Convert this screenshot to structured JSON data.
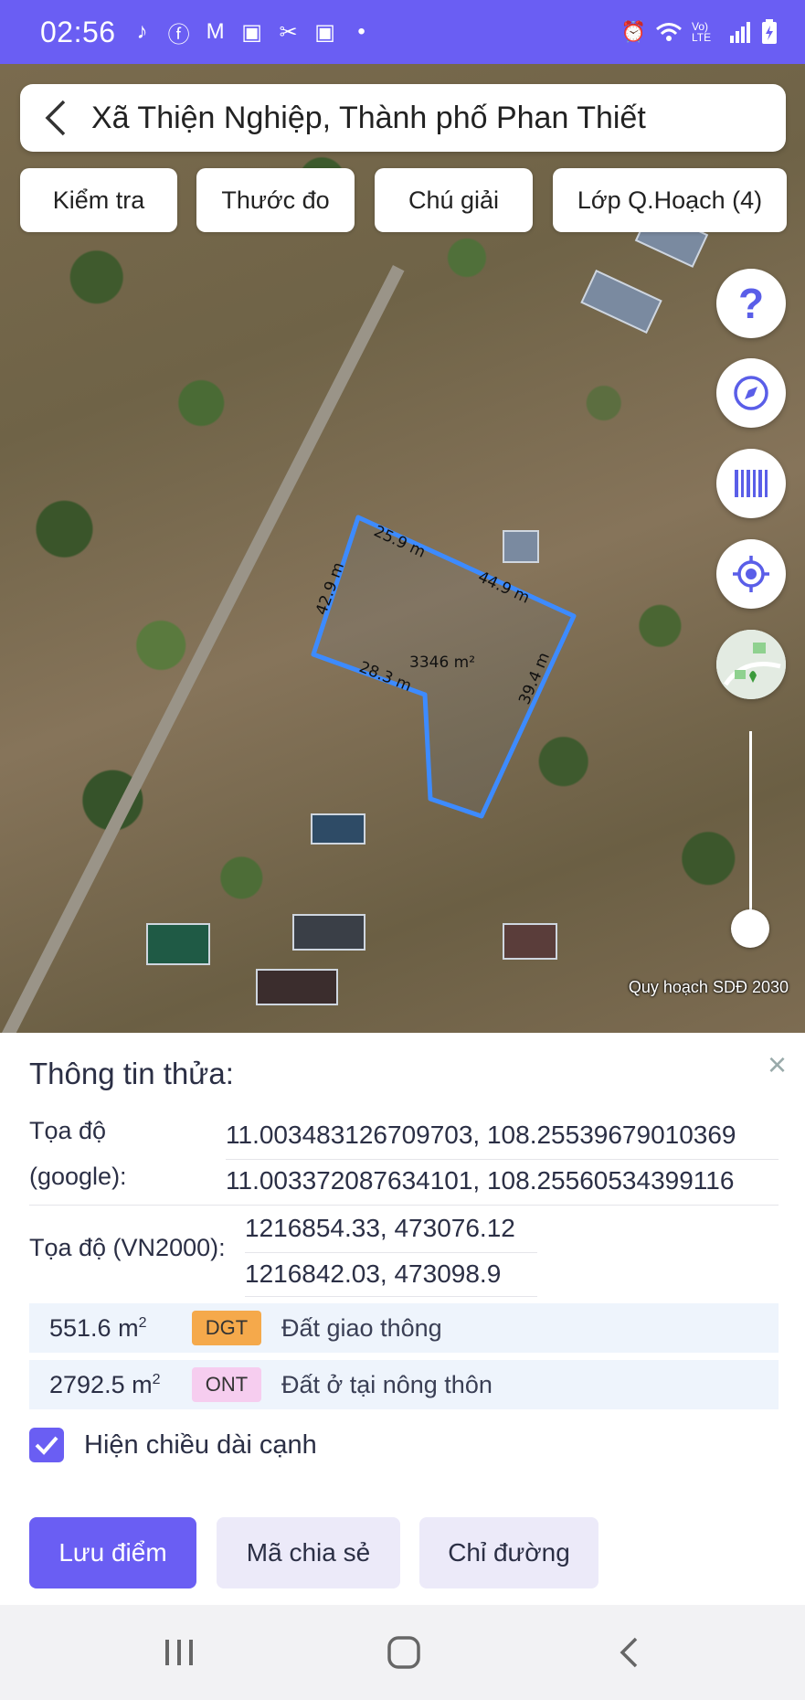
{
  "status_bar": {
    "time": "02:56",
    "left_icons": [
      "tiktok-icon",
      "facebook-icon",
      "gmail-icon",
      "app-icon",
      "scissors-icon",
      "app-icon",
      "dot-icon"
    ],
    "right_icons": [
      "alarm-icon",
      "wifi-icon",
      "volte-icon",
      "signal-icon",
      "battery-charging-icon"
    ],
    "volte_label": "Vo) LTE"
  },
  "header": {
    "title": "Xã Thiện Nghiệp, Thành phố Phan Thiết"
  },
  "chips": [
    {
      "label": "Kiểm tra"
    },
    {
      "label": "Thước đo"
    },
    {
      "label": "Chú giải"
    },
    {
      "label": "Lớp Q.Hoạch (4)"
    }
  ],
  "map": {
    "fab_help": "?",
    "parcel": {
      "area_label": "3346 m²",
      "edges": [
        "25.9 m",
        "44.9 m",
        "39.4 m",
        "28.3 m",
        "42.9 m"
      ]
    },
    "attribution": "Quy hoạch SDĐ 2030"
  },
  "sheet": {
    "title": "Thông tin thửa:",
    "close": "×",
    "google_label_1": "Tọa độ",
    "google_label_2": "(google):",
    "google_values": [
      "11.003483126709703, 108.25539679010369",
      "11.003372087634101, 108.25560534399116"
    ],
    "vn2000_label": "Tọa độ (VN2000):",
    "vn2000_values": [
      "1216854.33, 473076.12",
      "1216842.03, 473098.9"
    ],
    "land_uses": [
      {
        "area": "551.6 m",
        "sup": "2",
        "code": "DGT",
        "code_color": "#f5a94b",
        "desc": "Đất giao thông"
      },
      {
        "area": "2792.5 m",
        "sup": "2",
        "code": "ONT",
        "code_color": "#f6cdef",
        "desc": "Đất ở tại nông thôn"
      }
    ],
    "checkbox_label": "Hiện chiều dài cạnh",
    "checkbox_checked": true,
    "buttons": {
      "save": "Lưu điểm",
      "share": "Mã chia sẻ",
      "directions": "Chỉ đường"
    }
  },
  "colors": {
    "accent": "#6a5ef3",
    "parcel_outline": "#3d8bff",
    "secondary_button": "#eceaf9"
  }
}
